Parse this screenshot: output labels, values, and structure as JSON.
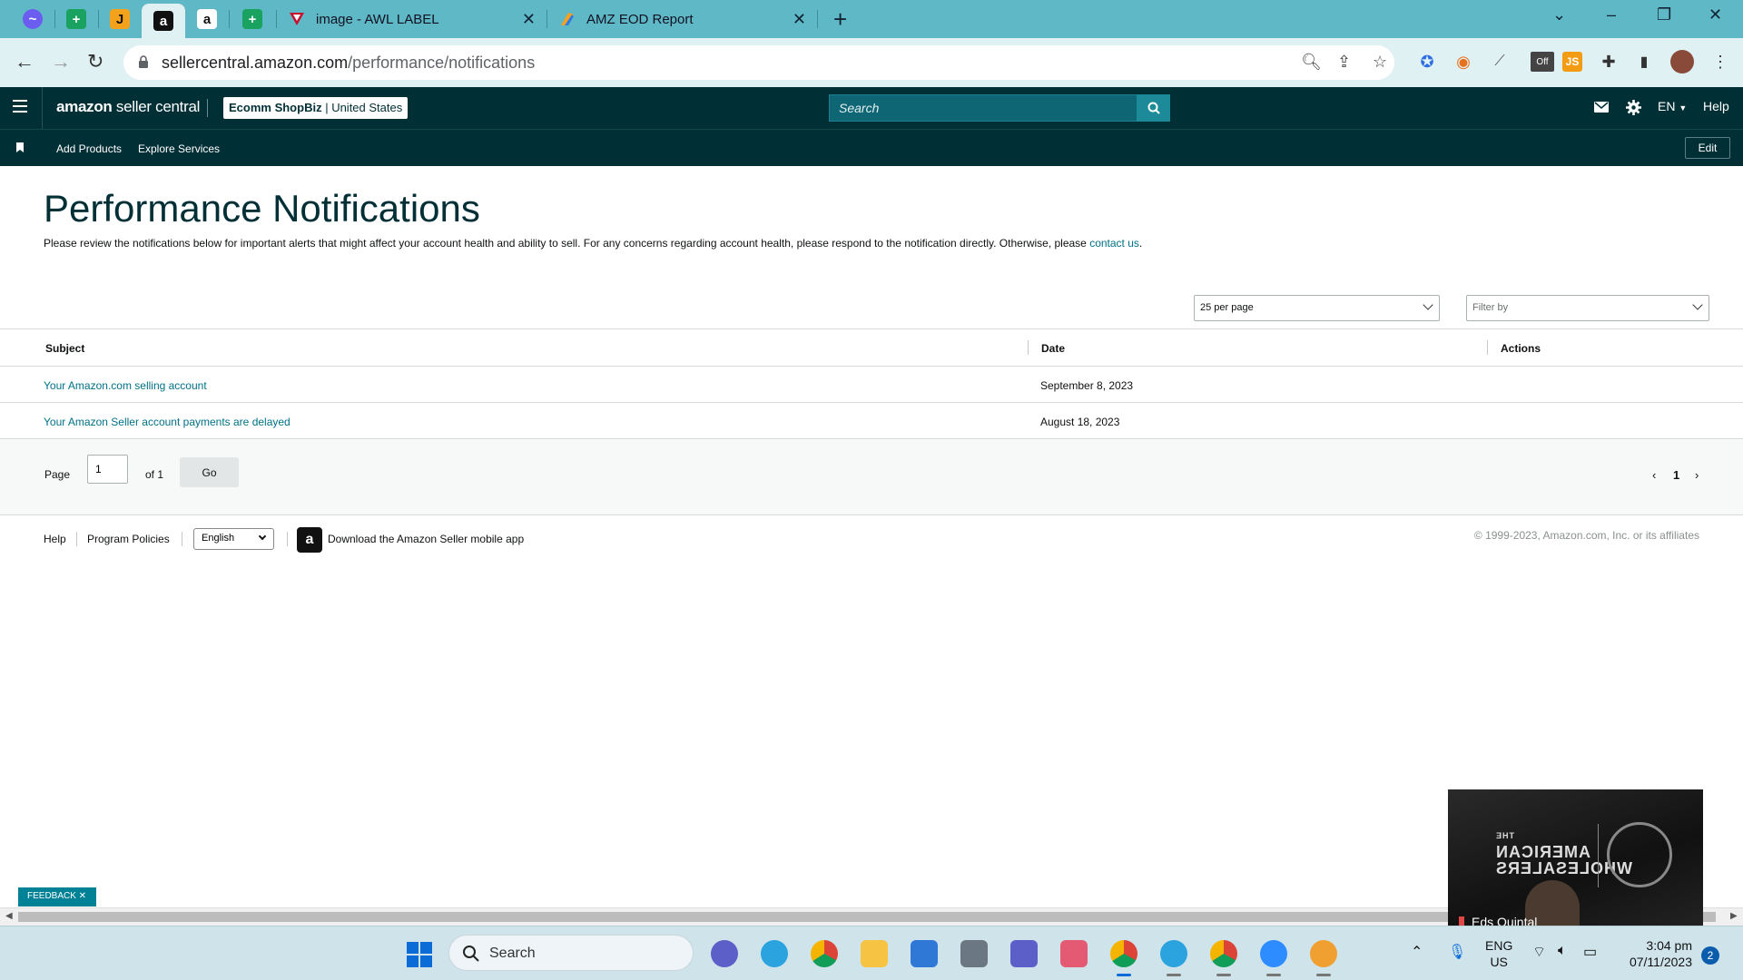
{
  "browser": {
    "tabs": [
      {
        "title": "image - AWL LABEL",
        "icon": "awl-logo-icon"
      },
      {
        "title": "AMZ EOD Report",
        "icon": "sheets-report-icon"
      }
    ],
    "pinned_tab_icons": [
      "messenger-icon",
      "sheets-icon",
      "jungle-scout-icon",
      "amazon-icon",
      "amazon-icon",
      "sheets-icon"
    ],
    "url_domain": "sellercentral.amazon.com",
    "url_path": "/performance/notifications",
    "extension_badge": "Off",
    "extension_js": "JS"
  },
  "header": {
    "logo_bold": "amazon",
    "logo_rest": " seller central",
    "account_name": "Ecomm ShopBiz",
    "account_region": "United States",
    "search_placeholder": "Search",
    "language": "EN",
    "help": "Help"
  },
  "subnav": {
    "items": [
      "Add Products",
      "Explore Services"
    ],
    "edit_label": "Edit"
  },
  "main": {
    "title": "Performance Notifications",
    "intro": "Please review the notifications below for important alerts that might affect your account health and ability to sell. For any concerns regarding account health, please respond to the notification directly. Otherwise, please ",
    "intro_link": "contact us",
    "intro_end": ".",
    "per_page": "25 per page",
    "filter_placeholder": "Filter by"
  },
  "table": {
    "headers": {
      "subject": "Subject",
      "date": "Date",
      "actions": "Actions"
    },
    "rows": [
      {
        "subject": "Your Amazon.com selling account",
        "date": "September 8, 2023"
      },
      {
        "subject": "Your Amazon Seller account payments are delayed",
        "date": "August 18, 2023"
      }
    ]
  },
  "pagination": {
    "page_label": "Page",
    "page_value": "1",
    "of_label": "of 1",
    "go_label": "Go",
    "current_page": "1"
  },
  "footer": {
    "help": "Help",
    "program_policies": "Program Policies",
    "language": "English",
    "app_text": "Download the Amazon Seller mobile app",
    "copyright": "© 1999-2023, Amazon.com, Inc. or its affiliates"
  },
  "feedback_label": "FEEDBACK ✕",
  "webcam": {
    "brand_line1": "THE",
    "brand_line2": "AMERICAN",
    "brand_line3": "WHOLESALERS",
    "participant": "Eds Quintal"
  },
  "taskbar": {
    "search_label": "Search",
    "lang_line1": "ENG",
    "lang_line2": "US",
    "time": "3:04 pm",
    "date": "07/11/2023",
    "notifications": "2"
  },
  "colors": {
    "tabstrip": "#5fb8c6",
    "header_bg": "#002f36",
    "link": "#007185",
    "search_bg": "#0e6574"
  }
}
